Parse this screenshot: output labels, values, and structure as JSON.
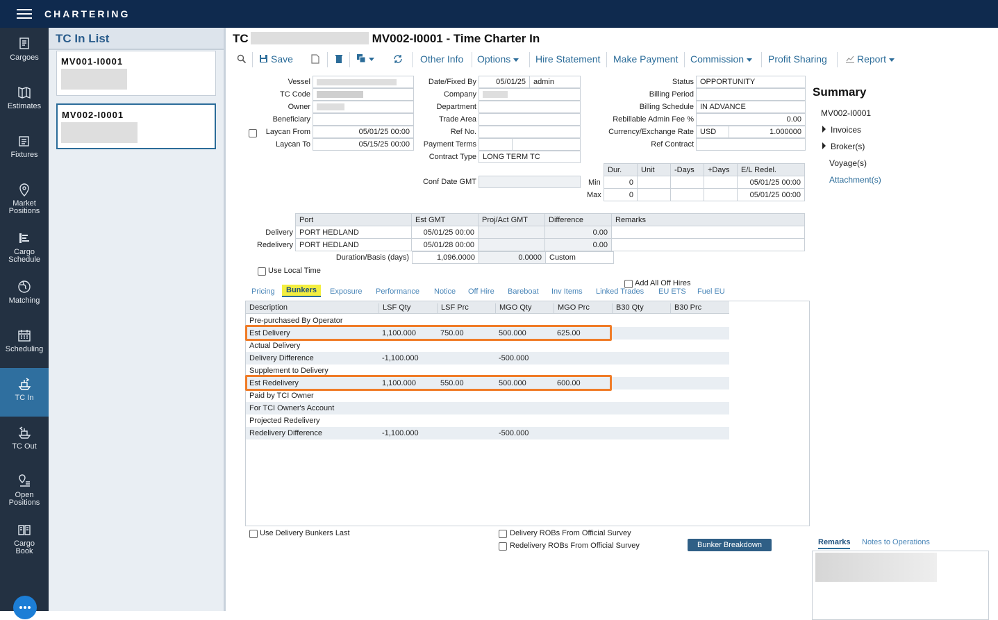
{
  "app": {
    "title": "CHARTERING"
  },
  "nav": {
    "items": [
      {
        "label": "Cargoes",
        "icon": "cargoes-icon"
      },
      {
        "label": "Estimates",
        "icon": "estimates-icon"
      },
      {
        "label": "Fixtures",
        "icon": "fixtures-icon"
      },
      {
        "label1": "Market",
        "label2": "Positions",
        "icon": "market-positions-icon"
      },
      {
        "label1": "Cargo",
        "label2": "Schedule",
        "icon": "cargo-schedule-icon"
      },
      {
        "label": "Matching",
        "icon": "matching-icon"
      },
      {
        "label": "Scheduling",
        "icon": "scheduling-icon"
      },
      {
        "label": "TC In",
        "icon": "tc-in-icon"
      },
      {
        "label": "TC Out",
        "icon": "tc-out-icon"
      },
      {
        "label1": "Open",
        "label2": "Positions",
        "icon": "open-positions-icon"
      },
      {
        "label1": "Cargo",
        "label2": "Book",
        "icon": "cargo-book-icon"
      }
    ],
    "active": "TC In"
  },
  "list": {
    "title": "TC In List",
    "items": [
      {
        "id": "MV001-I0001"
      },
      {
        "id": "MV002-I0001"
      }
    ]
  },
  "header": {
    "prefix": "TC",
    "title": "MV002-I0001 - Time Charter In"
  },
  "toolbar": {
    "save": "Save",
    "other_info": "Other Info",
    "options": "Options",
    "hire_statement": "Hire Statement",
    "make_payment": "Make Payment",
    "commission": "Commission",
    "profit_sharing": "Profit Sharing",
    "report": "Report"
  },
  "form": {
    "vessel_label": "Vessel",
    "tc_code_label": "TC Code",
    "owner_label": "Owner",
    "beneficiary_label": "Beneficiary",
    "laycan_from_label": "Laycan From",
    "laycan_from": "05/01/25 00:00",
    "laycan_to_label": "Laycan To",
    "laycan_to": "05/15/25 00:00",
    "date_fixed_label": "Date/Fixed By",
    "date_fixed": "05/01/25",
    "fixed_by": "admin",
    "company_label": "Company",
    "department_label": "Department",
    "trade_area_label": "Trade Area",
    "ref_no_label": "Ref No.",
    "payment_terms_label": "Payment Terms",
    "contract_type_label": "Contract Type",
    "contract_type": "LONG TERM TC",
    "conf_date_label": "Conf Date GMT",
    "status_label": "Status",
    "status": "OPPORTUNITY",
    "billing_period_label": "Billing Period",
    "billing_schedule_label": "Billing Schedule",
    "billing_schedule": "IN ADVANCE",
    "rebillable_label": "Rebillable Admin Fee %",
    "rebillable": "0.00",
    "currency_label": "Currency/Exchange Rate",
    "currency": "USD",
    "exchange_rate": "1.000000",
    "ref_contract_label": "Ref Contract"
  },
  "duration": {
    "headers": [
      "Dur.",
      "Unit",
      "-Days",
      "+Days",
      "E/L Redel."
    ],
    "min_label": "Min",
    "max_label": "Max",
    "min": [
      "0",
      "",
      "",
      "",
      "05/01/25 00:00"
    ],
    "max": [
      "0",
      "",
      "",
      "",
      "05/01/25 00:00"
    ]
  },
  "ports": {
    "headers": [
      "Port",
      "Est GMT",
      "Proj/Act GMT",
      "Difference",
      "Remarks"
    ],
    "delivery_label": "Delivery",
    "redelivery_label": "Redelivery",
    "delivery": [
      "PORT HEDLAND",
      "05/01/25 00:00",
      "",
      "0.00",
      ""
    ],
    "redelivery": [
      "PORT HEDLAND",
      "05/01/28 00:00",
      "",
      "0.00",
      ""
    ],
    "duration_label": "Duration/Basis (days)",
    "duration": "1,096.0000",
    "basis": "0.0000",
    "basis_type": "Custom"
  },
  "options": {
    "use_local_time": "Use Local Time",
    "add_all_off_hires": "Add All Off Hires"
  },
  "tabs": [
    "Pricing",
    "Bunkers",
    "Exposure",
    "Performance",
    "Notice",
    "Off Hire",
    "Bareboat",
    "Inv Items",
    "Linked Trades",
    "EU ETS",
    "Fuel EU"
  ],
  "active_tab": "Bunkers",
  "bunkers": {
    "headers": [
      "Description",
      "LSF Qty",
      "LSF Prc",
      "MGO Qty",
      "MGO Prc",
      "B30 Qty",
      "B30 Prc"
    ],
    "rows": [
      [
        "Pre-purchased By Operator",
        "",
        "",
        "",
        "",
        "",
        ""
      ],
      [
        "Est Delivery",
        "1,100.000",
        "750.00",
        "500.000",
        "625.00",
        "",
        ""
      ],
      [
        "Actual Delivery",
        "",
        "",
        "",
        "",
        "",
        ""
      ],
      [
        "Delivery Difference",
        "-1,100.000",
        "",
        "-500.000",
        "",
        "",
        ""
      ],
      [
        "Supplement to Delivery",
        "",
        "",
        "",
        "",
        "",
        ""
      ],
      [
        "Est Redelivery",
        "1,100.000",
        "550.00",
        "500.000",
        "600.00",
        "",
        ""
      ],
      [
        "Paid by TCI Owner",
        "",
        "",
        "",
        "",
        "",
        ""
      ],
      [
        "For TCI Owner's Account",
        "",
        "",
        "",
        "",
        "",
        ""
      ],
      [
        "Projected Redelivery",
        "",
        "",
        "",
        "",
        "",
        ""
      ],
      [
        "Redelivery Difference",
        "-1,100.000",
        "",
        "-500.000",
        "",
        "",
        ""
      ]
    ]
  },
  "footer": {
    "use_delivery_last": "Use Delivery Bunkers Last",
    "delivery_robs": "Delivery ROBs From Official Survey",
    "redelivery_robs": "Redelivery ROBs From Official Survey",
    "bunker_breakdown": "Bunker Breakdown"
  },
  "summary": {
    "title": "Summary",
    "id": "MV002-I0001",
    "invoices": "Invoices",
    "brokers": "Broker(s)",
    "voyages": "Voyage(s)",
    "attachments": "Attachment(s)"
  },
  "remarks": {
    "tab1": "Remarks",
    "tab2": "Notes to Operations"
  },
  "colors": {
    "topbar": "#0f2a4e",
    "nav": "#233142",
    "active_nav": "#2f6f9f",
    "link": "#2b6c99",
    "highlight": "#f07c28",
    "active_tab_bg": "#f3ee40"
  }
}
